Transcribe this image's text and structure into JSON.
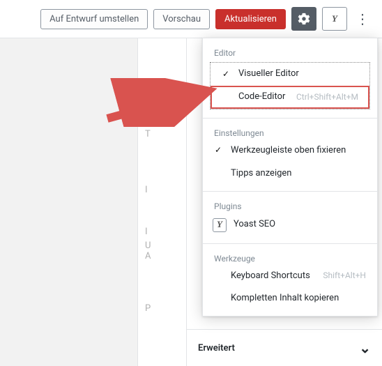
{
  "header": {
    "switch_to_draft": "Auf Entwurf umstellen",
    "preview": "Vorschau",
    "update": "Aktualisieren"
  },
  "menu": {
    "editor": {
      "heading": "Editor",
      "visual": "Visueller Editor",
      "code": "Code-Editor",
      "code_shortcut": "Ctrl+Shift+Alt+M"
    },
    "settings": {
      "heading": "Einstellungen",
      "fix_toolbar": "Werkzeugleiste oben fixieren",
      "show_tips": "Tipps anzeigen"
    },
    "plugins": {
      "heading": "Plugins",
      "yoast": "Yoast SEO"
    },
    "tools": {
      "heading": "Werkzeuge",
      "keyboard_shortcuts": "Keyboard Shortcuts",
      "keyboard_shortcuts_shortcut": "Shift+Alt+H",
      "copy_all": "Kompletten Inhalt kopieren"
    }
  },
  "sidebar": {
    "advanced": "Erweitert"
  },
  "icons": {
    "gear": "gear",
    "yoast_glyph": "Y",
    "kebab": "⋮",
    "check": "✓",
    "chevron_down": "⌄"
  },
  "ghost_letters": [
    "T",
    "I",
    "I",
    "U",
    "A",
    "P"
  ]
}
